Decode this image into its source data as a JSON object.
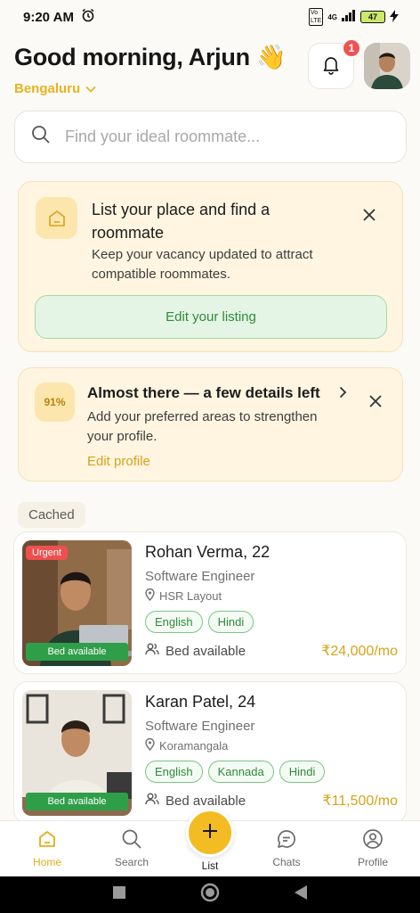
{
  "status_bar": {
    "time": "9:20 AM",
    "network": "4G",
    "battery": "47"
  },
  "header": {
    "greeting": "Good morning, Arjun",
    "greeting_emoji": "👋",
    "city": "Bengaluru",
    "notification_count": "1"
  },
  "search": {
    "placeholder": "Find your ideal roommate..."
  },
  "list_card": {
    "title": "List your place and find a roommate",
    "description": "Keep your vacancy updated to attract compatible roommates.",
    "button": "Edit your listing"
  },
  "profile_card": {
    "percent": "91%",
    "title": "Almost there — a few details left",
    "description": "Add your preferred areas to strengthen your profile.",
    "link": "Edit profile"
  },
  "section_label": "Cached",
  "listings": [
    {
      "urgent": "Urgent",
      "photo_tag": "Bed available",
      "name": "Rohan Verma, 22",
      "job": "Software Engineer",
      "location": "HSR Layout",
      "languages": [
        "English",
        "Hindi"
      ],
      "availability": "Bed available",
      "price": "₹24,000/mo"
    },
    {
      "photo_tag": "Bed available",
      "name": "Karan Patel, 24",
      "job": "Software Engineer",
      "location": "Koramangala",
      "languages": [
        "English",
        "Kannada",
        "Hindi"
      ],
      "availability": "Bed available",
      "price": "₹11,500/mo"
    }
  ],
  "bottom_nav": {
    "home": "Home",
    "search": "Search",
    "list": "List",
    "chats": "Chats",
    "profile": "Profile"
  },
  "colors": {
    "accent": "#f2bc22",
    "green": "#2f8a3a",
    "urgent": "#ef4f4f"
  }
}
